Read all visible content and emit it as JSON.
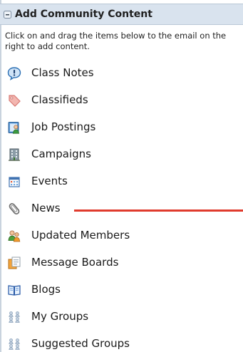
{
  "panel": {
    "title": "Add Community Content",
    "instructions": "Click on and drag the items below to the email on the right to add content."
  },
  "items": [
    {
      "label": "Class Notes",
      "icon": "class-notes-icon"
    },
    {
      "label": "Classifieds",
      "icon": "classifieds-tag-icon"
    },
    {
      "label": "Job Postings",
      "icon": "job-postings-icon"
    },
    {
      "label": "Campaigns",
      "icon": "campaigns-building-icon"
    },
    {
      "label": "Events",
      "icon": "events-calendar-icon"
    },
    {
      "label": "News",
      "icon": "news-paperclip-icon"
    },
    {
      "label": "Updated Members",
      "icon": "updated-members-icon"
    },
    {
      "label": "Message Boards",
      "icon": "message-boards-icon"
    },
    {
      "label": "Blogs",
      "icon": "blogs-book-icon"
    },
    {
      "label": "My Groups",
      "icon": "my-groups-icon"
    },
    {
      "label": "Suggested Groups",
      "icon": "suggested-groups-icon"
    }
  ],
  "colors": {
    "header_background": "#d9e3ee",
    "annotation_line": "#e03b2d"
  }
}
